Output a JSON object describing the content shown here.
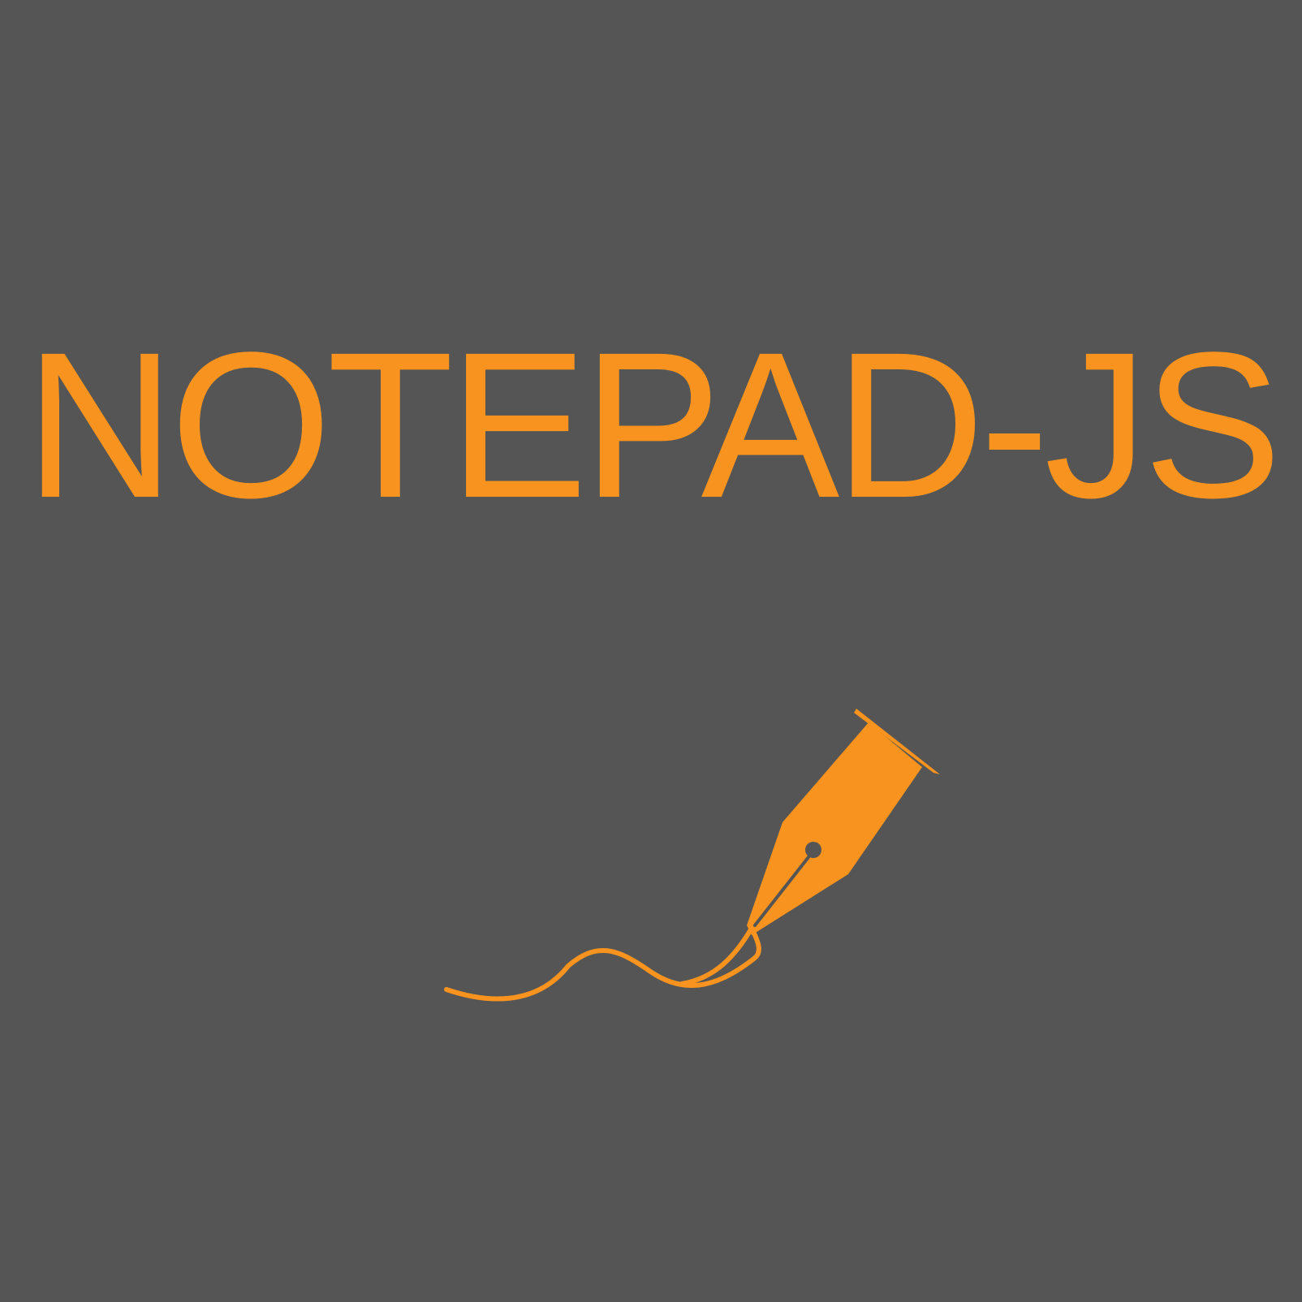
{
  "logo": {
    "title": "NOTEPAD-JS",
    "icon": "fountain-pen-icon",
    "colors": {
      "background": "#545554",
      "accent": "#F7931E"
    }
  }
}
